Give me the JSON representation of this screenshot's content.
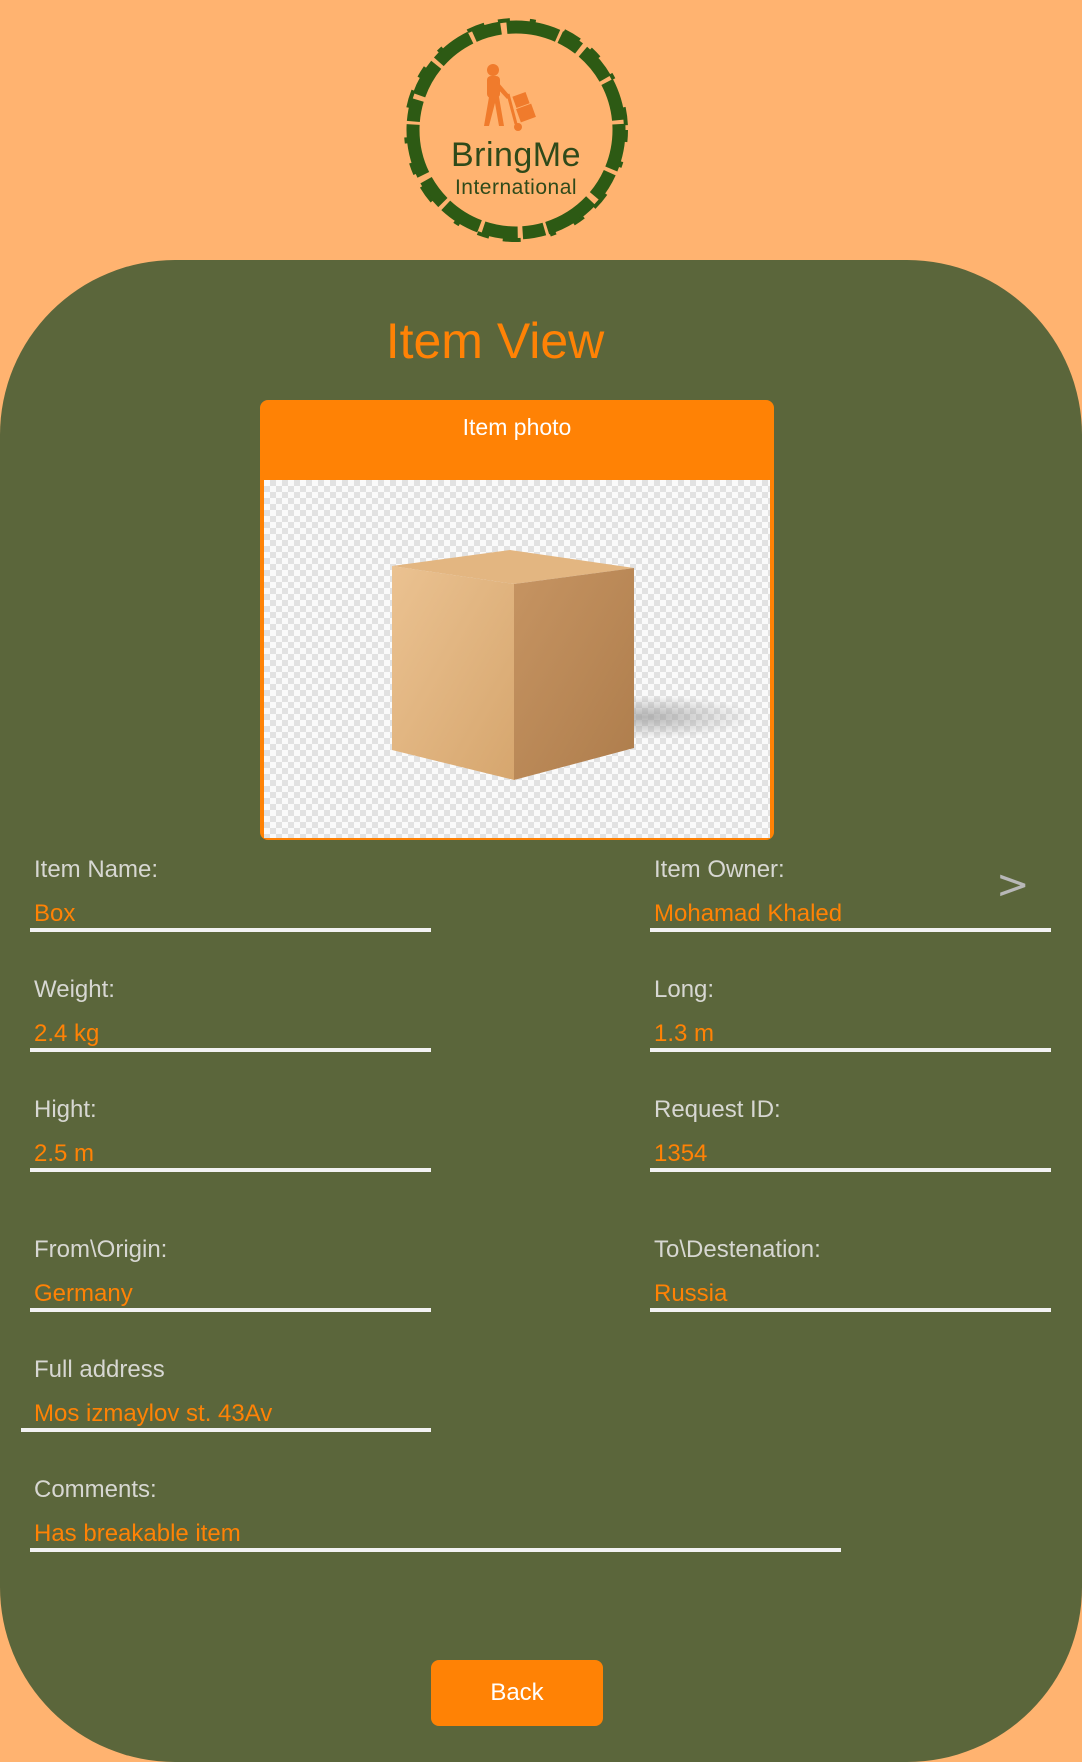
{
  "logo": {
    "brand": "BringMe",
    "sub": "International",
    "colors": {
      "ring": "#2D5A14",
      "figure": "#F07B2C"
    }
  },
  "page": {
    "title": "Item View"
  },
  "photo": {
    "label": "Item photo",
    "image": "cardboard-box"
  },
  "fields": {
    "item_name": {
      "label": "Item Name:",
      "value": "Box"
    },
    "item_owner": {
      "label": "Item Owner:",
      "value": "Mohamad Khaled"
    },
    "weight": {
      "label": "Weight:",
      "value": "2.4 kg"
    },
    "long": {
      "label": "Long:",
      "value": "1.3 m"
    },
    "hight": {
      "label": "Hight:",
      "value": "2.5 m"
    },
    "request_id": {
      "label": "Request ID:",
      "value": "1354"
    },
    "origin": {
      "label": "From\\Origin:",
      "value": "Germany"
    },
    "destination": {
      "label": "To\\Destenation:",
      "value": "Russia"
    },
    "full_address": {
      "label": "Full address",
      "value": "Mos izmaylov st. 43Av"
    },
    "comments": {
      "label": "Comments:",
      "value": "Has breakable item"
    }
  },
  "owner_link_icon": ">",
  "back_button": {
    "label": "Back"
  },
  "colors": {
    "background": "#FFB370",
    "panel": "#5B663B",
    "accent": "#FF8205",
    "label_text": "#D7D7D2",
    "underline": "#F2F2F2"
  }
}
